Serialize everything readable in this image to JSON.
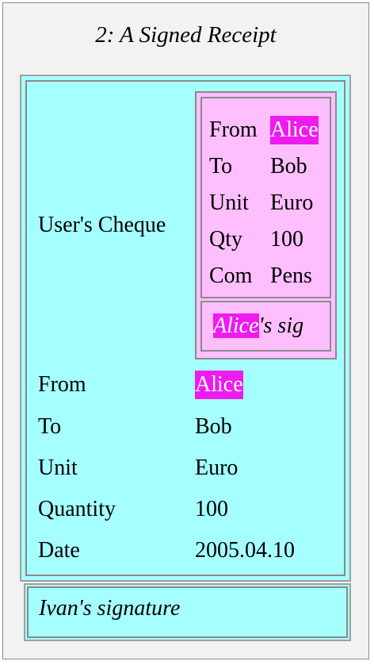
{
  "title": "2: A Signed Receipt",
  "colors": {
    "receipt_bg": "#a6ffff",
    "cheque_bg": "#ffbfff",
    "highlight": "#ee1aee",
    "page_bg": "#f2f2f2"
  },
  "receipt": {
    "cheque_label": "User's Cheque",
    "cheque": {
      "rows": [
        {
          "key": "From",
          "value": "Alice"
        },
        {
          "key": "To",
          "value": "Bob"
        },
        {
          "key": "Unit",
          "value": "Euro"
        },
        {
          "key": "Qty",
          "value": "100"
        },
        {
          "key": "Com",
          "value": "Pens"
        }
      ],
      "signer": "Alice",
      "sig_suffix": "'s sig"
    },
    "fields": [
      {
        "key": "From",
        "value": "Alice"
      },
      {
        "key": "To",
        "value": "Bob"
      },
      {
        "key": "Unit",
        "value": "Euro"
      },
      {
        "key": "Quantity",
        "value": "100"
      },
      {
        "key": "Date",
        "value": "2005.04.10"
      }
    ]
  },
  "signature": "Ivan's signature"
}
